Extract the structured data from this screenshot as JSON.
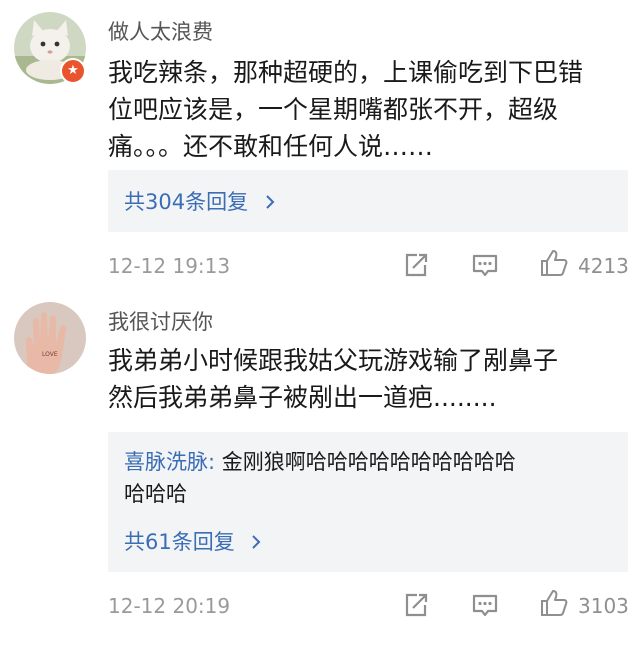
{
  "comments": [
    {
      "username": "做人太浪费",
      "avatar_icon": "cat-photo-avatar",
      "badge_icon": "verified-star-badge-icon",
      "text_lines": [
        "我吃辣条，那种超硬的，上课偷吃到下巴错",
        "位吧应该是，一个星期嘴都张不开，超级",
        "痛。。。还不敢和任何人说……"
      ],
      "reply_count_label": "共304条回复",
      "timestamp": "12-12 19:13",
      "like_count": "4213"
    },
    {
      "username": "我很讨厌你",
      "avatar_icon": "hand-photo-avatar",
      "text_lines": [
        "我弟弟小时候跟我姑父玩游戏输了剐鼻子",
        "然后我弟弟鼻子被剐出一道疤........"
      ],
      "reply": {
        "author": "喜脉洗脉:",
        "text_line_1": " 金刚狼啊哈哈哈哈哈哈哈哈哈哈",
        "text_line_2": "哈哈哈"
      },
      "reply_count_label": "共61条回复",
      "timestamp": "12-12 20:19",
      "like_count": "3103"
    }
  ],
  "icons": {
    "share": "share-icon",
    "comment": "comment-icon",
    "like": "like-thumb-icon",
    "chevron": "chevron-right-icon"
  },
  "colors": {
    "link_blue": "#3b6db5",
    "reply_bg": "#f3f4f6",
    "badge_orange": "#e8542e",
    "meta_gray": "#9a9a9a"
  }
}
